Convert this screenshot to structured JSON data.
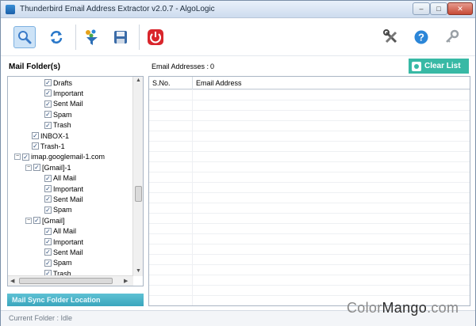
{
  "window": {
    "title": "Thunderbird Email Address Extractor v2.0.7 - AlgoLogic",
    "controls": {
      "minimize": "–",
      "maximize": "□",
      "close": "✕"
    }
  },
  "toolbar": {
    "left_buttons": [
      {
        "name": "search-icon",
        "color": "#3a7bc8"
      },
      {
        "name": "refresh-icon",
        "color": "#2a78c9"
      },
      {
        "name": "filter-icon",
        "color": "#e6a21a"
      },
      {
        "name": "save-icon",
        "color": "#3b6ca8"
      },
      {
        "name": "power-icon",
        "color": "#d9262c"
      }
    ],
    "right_buttons": [
      {
        "name": "tools-icon",
        "color": "#555555"
      },
      {
        "name": "help-icon",
        "color": "#2b86d8"
      },
      {
        "name": "key-icon",
        "color": "#9aa0a6"
      }
    ]
  },
  "left_panel": {
    "header": "Mail Folder(s)",
    "tree": [
      {
        "label": "Drafts",
        "checked": true
      },
      {
        "label": "Important",
        "checked": true
      },
      {
        "label": "Sent Mail",
        "checked": true
      },
      {
        "label": "Spam",
        "checked": true
      },
      {
        "label": "Trash",
        "checked": true
      },
      {
        "label": "INBOX-1",
        "checked": true
      },
      {
        "label": "Trash-1",
        "checked": true
      },
      {
        "label": "imap.googlemail-1.com",
        "checked": true,
        "expanded": true
      },
      {
        "label": "[Gmail]-1",
        "checked": true,
        "expanded": true
      },
      {
        "label": "All Mail",
        "checked": true
      },
      {
        "label": "Important",
        "checked": true
      },
      {
        "label": "Sent Mail",
        "checked": true
      },
      {
        "label": "Spam",
        "checked": true
      },
      {
        "label": "[Gmail]",
        "checked": true,
        "expanded": true
      },
      {
        "label": "All Mail",
        "checked": true
      },
      {
        "label": "Important",
        "checked": true
      },
      {
        "label": "Sent Mail",
        "checked": true
      },
      {
        "label": "Spam",
        "checked": true
      },
      {
        "label": "Trash",
        "checked": true
      }
    ],
    "sync_button": "Mail Sync Folder Location"
  },
  "right_panel": {
    "count_label": "Email Addresses :",
    "count_value": "0",
    "clear_button": "Clear List",
    "columns": [
      "S.No.",
      "Email Address"
    ]
  },
  "status": {
    "text": "Current Folder :  Idle"
  },
  "watermark": {
    "part1": "Color",
    "part2": "Mango",
    "part3": ".com"
  },
  "colors": {
    "accent_teal": "#38b9a5",
    "sync_bar": "#3aa6bd",
    "selected_tool": "#cde3f7"
  }
}
